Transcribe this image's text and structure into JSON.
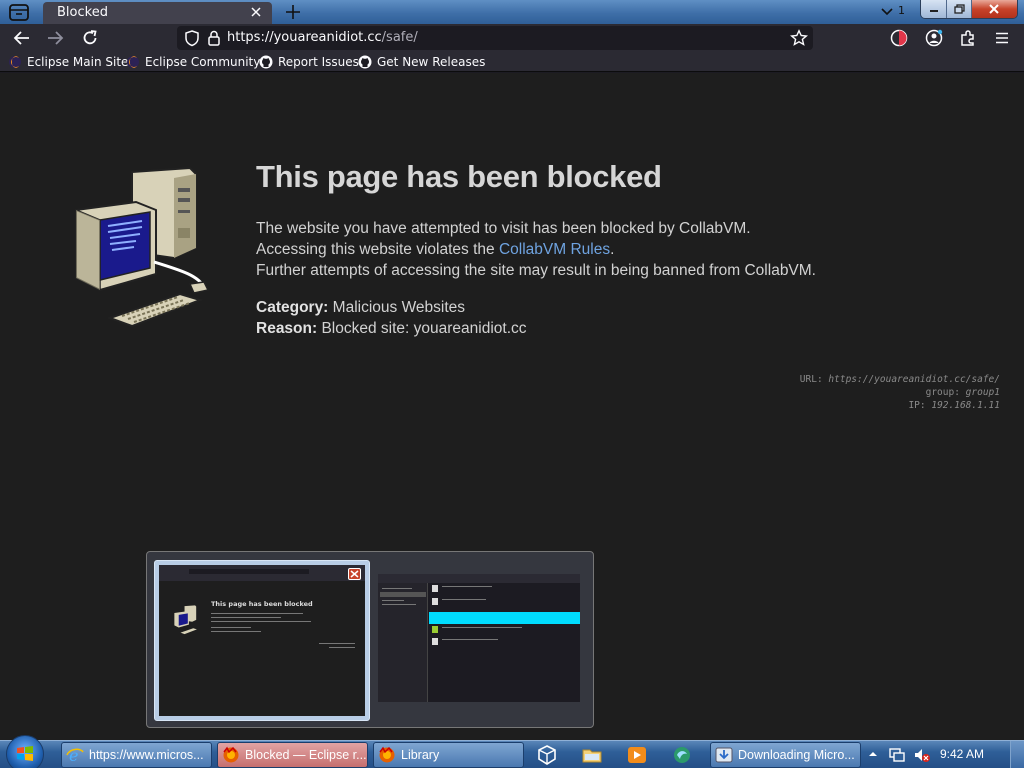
{
  "browser": {
    "tab_title": "Blocked",
    "all_tabs_count": "1",
    "url_host": "https://youareanidiot.cc",
    "url_path": "/safe/"
  },
  "bookmarks": [
    "Eclipse Main Site",
    "Eclipse Community",
    "Report Issues",
    "Get New Releases"
  ],
  "page": {
    "heading": "This page has been blocked",
    "line1": "The website you have attempted to visit has been blocked by CollabVM.",
    "line2_prefix": "Accessing this website violates the ",
    "line2_link": "CollabVM Rules",
    "line2_suffix": ".",
    "line3": "Further attempts of accessing the site may result in being banned from CollabVM.",
    "category_label": "Category:",
    "category_value": "Malicious Websites",
    "reason_label": "Reason:",
    "reason_value": "Blocked site: youareanidiot.cc",
    "meta_url_label": "URL:",
    "meta_url_value": "https://youareanidiot.cc/safe/",
    "meta_group_label": "group:",
    "meta_group_value": "group1",
    "meta_ip_label": "IP:",
    "meta_ip_value": "192.168.1.11"
  },
  "switcher": {
    "thumb1_title": "This page has been blocked"
  },
  "taskbar": {
    "tasks": [
      "https://www.micros...",
      "Blocked — Eclipse r...",
      "Library",
      "Downloading Micro..."
    ],
    "clock": "9:42 AM"
  },
  "colors": {
    "page_bg": "#1e1e1e",
    "link": "#6fa3e0",
    "toolbar": "#2b2a33",
    "urlbar": "#1c1b22",
    "taskbar": "#2f5f98"
  }
}
